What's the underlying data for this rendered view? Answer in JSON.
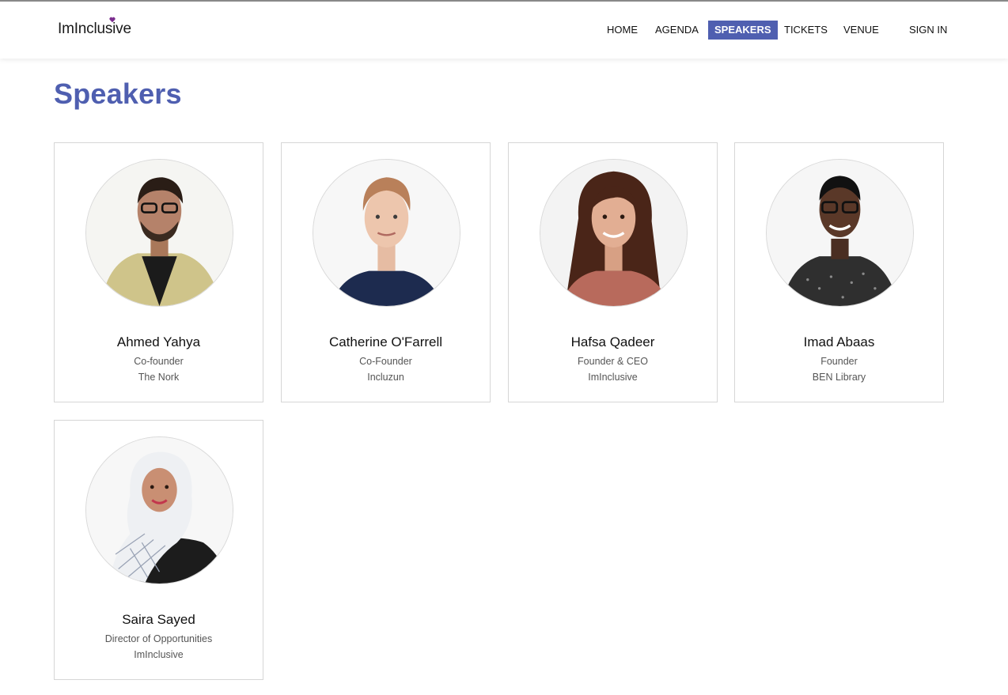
{
  "header": {
    "logo_text": "ImInclusive",
    "nav": [
      {
        "label": "HOME"
      },
      {
        "label": "AGENDA"
      },
      {
        "label": "SPEAKERS",
        "active": true
      },
      {
        "label": "TICKETS"
      },
      {
        "label": "VENUE"
      },
      {
        "label": "SIGN IN"
      }
    ]
  },
  "page": {
    "title": "Speakers"
  },
  "speakers": [
    {
      "name": "Ahmed Yahya",
      "role": "Co-founder",
      "org": "The Nork"
    },
    {
      "name": "Catherine O'Farrell",
      "role": "Co-Founder",
      "org": "Incluzun"
    },
    {
      "name": "Hafsa Qadeer",
      "role": "Founder & CEO",
      "org": "ImInclusive"
    },
    {
      "name": "Imad Abaas",
      "role": "Founder",
      "org": "BEN Library"
    },
    {
      "name": "Saira Sayed",
      "role": "Director of Opportunities",
      "org": "ImInclusive"
    }
  ],
  "colors": {
    "accent": "#4f5fb0",
    "heart": "#7b2d8e"
  }
}
